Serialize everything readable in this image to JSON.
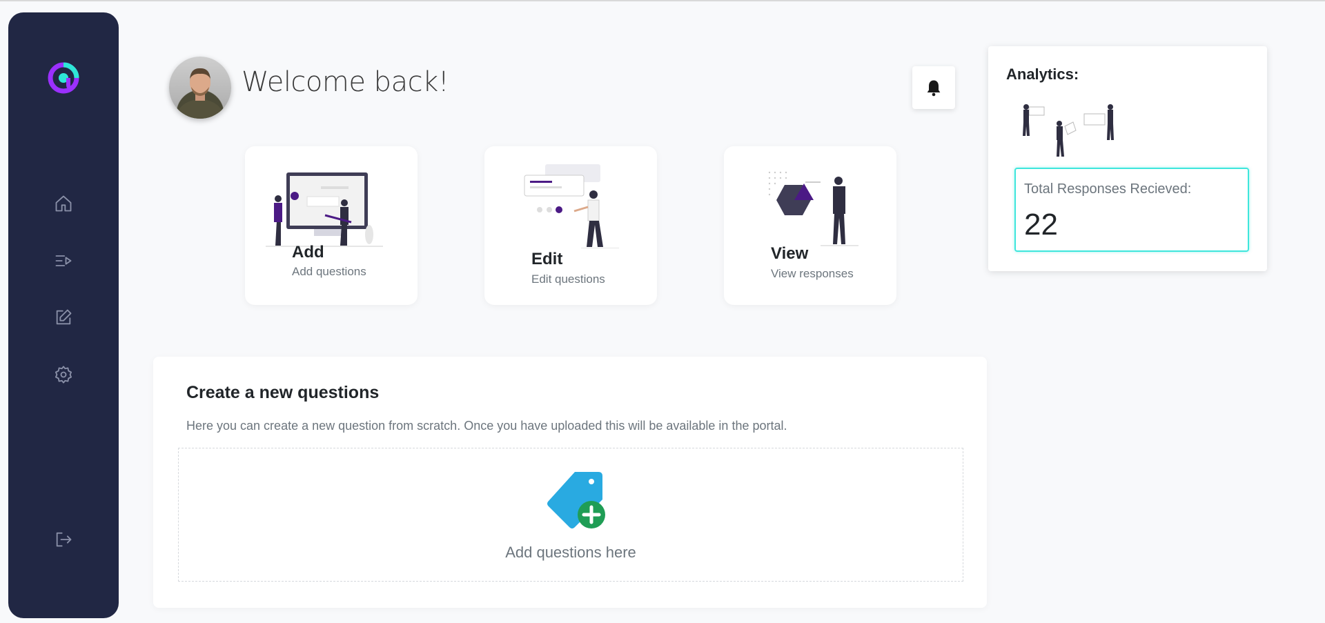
{
  "header": {
    "welcome_text": "Welcome back!"
  },
  "sidebar": {
    "items": [
      {
        "icon": "home-icon",
        "label": "Home"
      },
      {
        "icon": "playlist-icon",
        "label": "Questions"
      },
      {
        "icon": "edit-icon",
        "label": "Edit"
      },
      {
        "icon": "settings-icon",
        "label": "Settings"
      },
      {
        "icon": "logout-icon",
        "label": "Logout"
      }
    ]
  },
  "cards": [
    {
      "title": "Add",
      "subtitle": "Add questions"
    },
    {
      "title": "Edit",
      "subtitle": "Edit questions"
    },
    {
      "title": "View",
      "subtitle": "View responses"
    }
  ],
  "analytics": {
    "title": "Analytics:",
    "responses_label": "Total Responses Recieved:",
    "responses_count": "22"
  },
  "create": {
    "title": "Create a new questions",
    "description": "Here you can create a new question from scratch. Once you have uploaded this will be available in the portal.",
    "dropzone_label": "Add questions here"
  },
  "colors": {
    "sidebar_bg": "#212744",
    "logo_purple": "#9b30ff",
    "logo_teal": "#2ee6d6",
    "accent_purple": "#4b1a85",
    "response_border": "#3ee6dc",
    "tag_blue": "#29aae1",
    "plus_green": "#1f9d55"
  }
}
